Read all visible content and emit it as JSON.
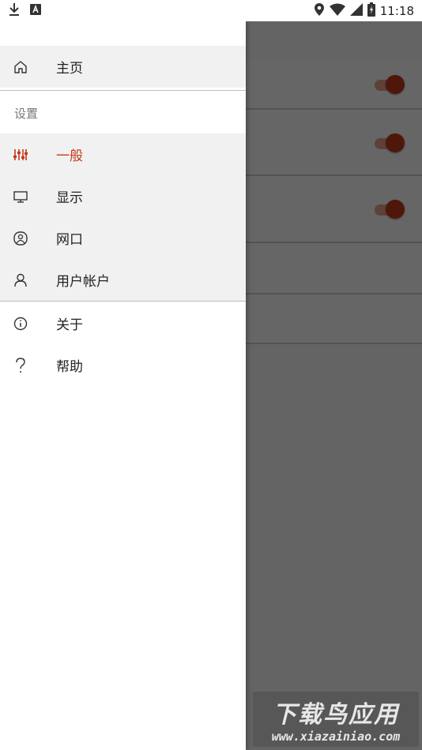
{
  "status_bar": {
    "time": "11:18",
    "left_icons": [
      "download-icon",
      "font-a-icon"
    ],
    "right_icons": [
      "location-pin-icon",
      "wifi-icon",
      "cell-signal-icon",
      "battery-charging-icon"
    ]
  },
  "drawer": {
    "home": {
      "label": "主页",
      "icon": "home-icon"
    },
    "settings_section": "设置",
    "settings_items": [
      {
        "label": "一般",
        "icon": "sliders-icon",
        "selected": true
      },
      {
        "label": "显示",
        "icon": "monitor-icon",
        "selected": false
      },
      {
        "label": "网口",
        "icon": "portal-icon",
        "selected": false
      },
      {
        "label": "用户帐户",
        "icon": "user-icon",
        "selected": false
      }
    ],
    "about": {
      "label": "关于",
      "icon": "info-icon"
    },
    "help": {
      "label": "帮助",
      "icon": "question-icon"
    }
  },
  "background": {
    "toggles": [
      true,
      true,
      true
    ]
  },
  "watermark": {
    "main": "下载鸟应用",
    "sub": "www.xiazainiao.com"
  },
  "colors": {
    "accent": "#c5391a",
    "scrim": "#000000",
    "selected_bg": "#f1f1f1"
  }
}
